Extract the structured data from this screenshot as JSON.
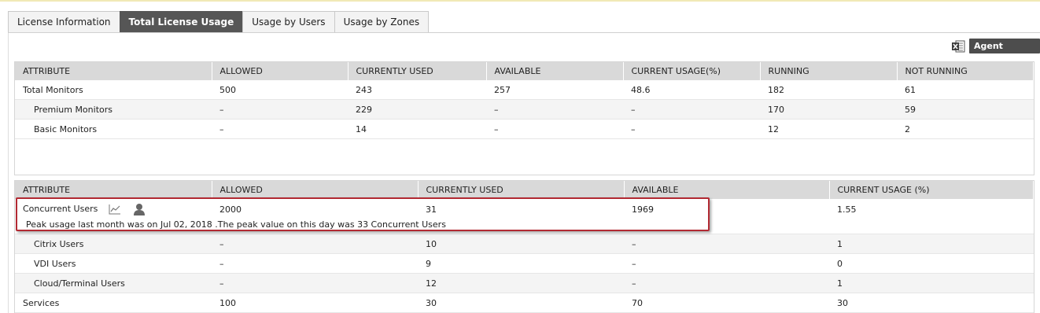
{
  "tabs": [
    {
      "label": "License Information",
      "active": false
    },
    {
      "label": "Total License Usage",
      "active": true
    },
    {
      "label": "Usage by Users",
      "active": false
    },
    {
      "label": "Usage by Zones",
      "active": false
    }
  ],
  "toolbar": {
    "agent_status_label": "Agent Status",
    "export_icon": "excel-export-icon"
  },
  "monitors_table": {
    "headers": [
      "ATTRIBUTE",
      "ALLOWED",
      "CURRENTLY USED",
      "AVAILABLE",
      "CURRENT USAGE(%)",
      "RUNNING",
      "NOT RUNNING"
    ],
    "rows": [
      [
        "Total Monitors",
        "500",
        "243",
        "257",
        "48.6",
        "182",
        "61"
      ],
      [
        "Premium Monitors",
        "–",
        "229",
        "–",
        "–",
        "170",
        "59"
      ],
      [
        "Basic Monitors",
        "–",
        "14",
        "–",
        "–",
        "12",
        "2"
      ]
    ]
  },
  "users_table": {
    "headers": [
      "ATTRIBUTE",
      "ALLOWED",
      "CURRENTLY USED",
      "AVAILABLE",
      "CURRENT USAGE (%)"
    ],
    "concurrent": [
      "Concurrent Users",
      "2000",
      "31",
      "1969",
      "1.55"
    ],
    "peak_note": "Peak usage last month was on Jul 02, 2018 .The peak value on this day was  33 Concurrent Users",
    "rows": [
      [
        "Citrix Users",
        "–",
        "10",
        "–",
        "1"
      ],
      [
        "VDI Users",
        "–",
        "9",
        "–",
        "0"
      ],
      [
        "Cloud/Terminal Users",
        "–",
        "12",
        "–",
        "1"
      ],
      [
        "Services",
        "100",
        "30",
        "70",
        "30"
      ]
    ]
  },
  "colors": {
    "active_tab": "#565656",
    "highlight_border": "#b22a33",
    "header_bg": "#d9d9d9"
  }
}
